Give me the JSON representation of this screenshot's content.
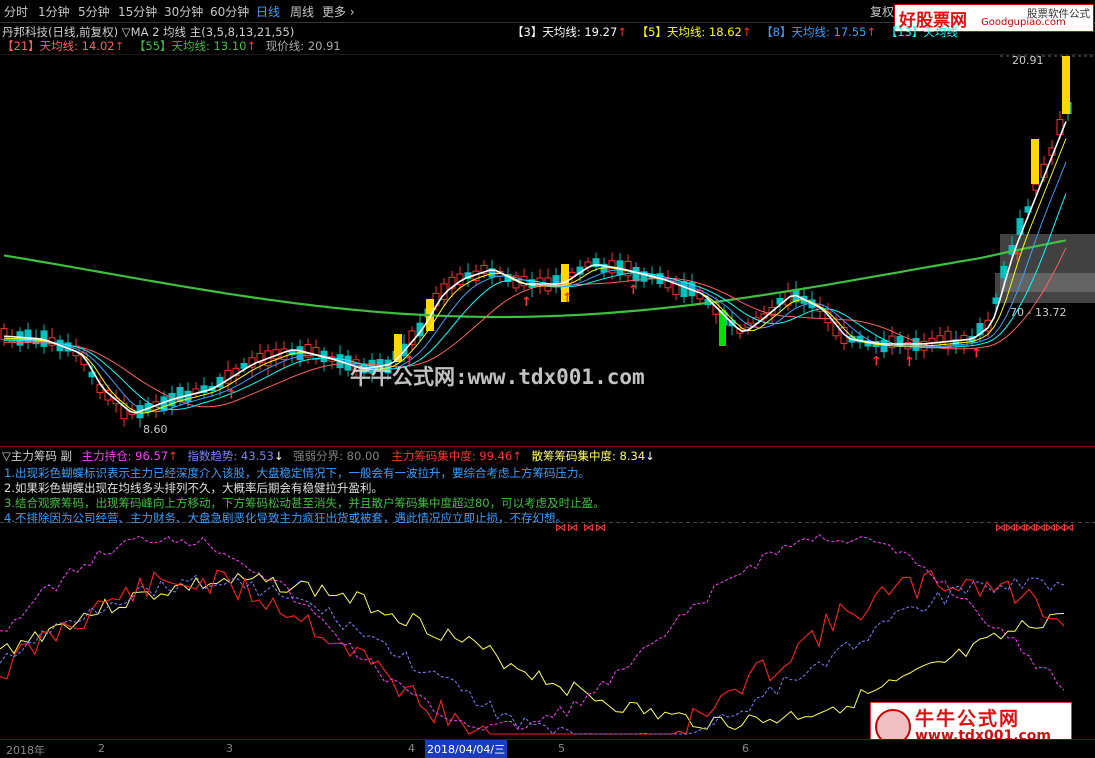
{
  "toolbar": {
    "tabs": [
      "分时",
      "1分钟",
      "5分钟",
      "15分钟",
      "30分钟",
      "60分钟",
      "日线",
      "周线",
      "更多"
    ],
    "active_tab": "日线",
    "right_label": "复权"
  },
  "header": {
    "stock_title": "丹邦科技(日线,前复权)",
    "indicator": "▽MA 2 均线 主(3,5,8,13,21,55)",
    "ma3": "【3】天均线: 19.27",
    "ma5": "【5】天均线: 18.62",
    "ma8": "【8】天均线: 17.55",
    "ma13": "【13】天均线",
    "ma21": "【21】天均线: 14.02",
    "ma55": "【55】天均线: 13.10",
    "current": "现价线: 20.91"
  },
  "main_chart": {
    "high_label": "20.91",
    "low_label": "8.60",
    "side_label": "70 - 13.72",
    "watermark": "牛牛公式网:www.tdx001.com"
  },
  "sub_panel": {
    "title": "▽主力筹码 副",
    "hold_label": "主力持仓: 96.57",
    "index_label": "指数趋势: 43.53",
    "strong_label": "强弱分界: 80.00",
    "concentration_label": "主力筹码集中度: 99.46",
    "retail_label": "散筹筹码集中度: 8.34",
    "notes": [
      "1.出现彩色蝴蝶标识表示主力已经深度介入该股，大盘稳定情况下，一般会有一波拉升，要综合考虑上方筹码压力。",
      "2.如果彩色蝴蝶出现在均线多头排列不久，大概率后期会有稳健拉升盈利。",
      "3.结合观察筹码，出现筹码峰向上方移动，下方筹码松动甚至消失，并且散户筹码集中度超过80，可以考虑及时止盈。",
      "4.不排除因为公司经营、主力财务、大盘急剧恶化导致主力疯狂出货或被套，遇此情况应立即止损，不存幻想。"
    ]
  },
  "bottom_axis": {
    "year": "2018年",
    "m2": "2",
    "m3": "3",
    "m4": "4",
    "date": "2018/04/04/三",
    "m5": "5",
    "m6": "6"
  },
  "brand": {
    "top_logo": "好股票网",
    "top_url": "Goodgupiao.com",
    "top_tag": "股票软件公式",
    "bottom_logo": "牛牛公式网",
    "bottom_url": "www.tdx001.com"
  },
  "colors": {
    "bg": "#000000",
    "ma3": "#ffffff",
    "ma5": "#ffff00",
    "ma8": "#3aa0ff",
    "ma13": "#00ffff",
    "ma21": "#ff6060",
    "ma55": "#40c040",
    "up": "#ff3030",
    "down": "#00c0c0",
    "yellow": "#ffd700",
    "accent": "#3aa0ff"
  }
}
